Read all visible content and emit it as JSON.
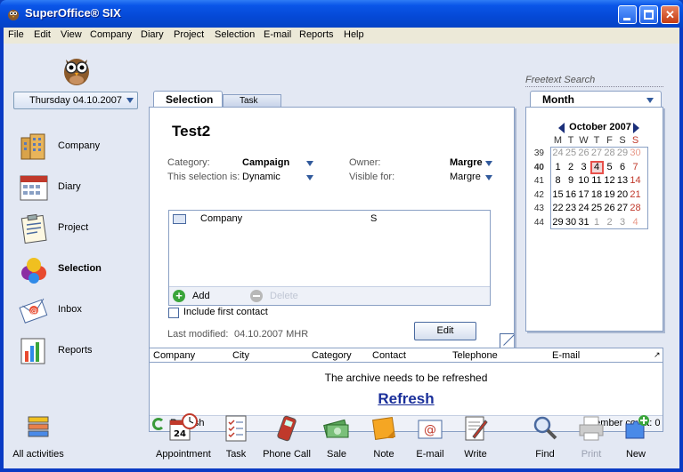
{
  "window": {
    "title": "SuperOffice® SIX"
  },
  "menu": [
    "File",
    "Edit",
    "View",
    "Company",
    "Diary",
    "Project",
    "Selection",
    "E-mail",
    "Reports",
    "Help"
  ],
  "date_select": {
    "value": "Thursday 04.10.2007"
  },
  "nav": [
    {
      "label": "Company",
      "icon": "company-building-icon"
    },
    {
      "label": "Diary",
      "icon": "diary-calendar-icon"
    },
    {
      "label": "Project",
      "icon": "project-clipboard-icon"
    },
    {
      "label": "Selection",
      "icon": "selection-balls-icon",
      "active": true
    },
    {
      "label": "Inbox",
      "icon": "inbox-envelope-icon"
    },
    {
      "label": "Reports",
      "icon": "reports-chart-icon"
    }
  ],
  "tabs": {
    "selection": "Selection",
    "task": "Task"
  },
  "selection": {
    "title": "Test2",
    "category_label": "Category:",
    "category_value": "Campaign",
    "type_label": "This selection is:",
    "type_value": "Dynamic",
    "owner_label": "Owner:",
    "owner_value": "Margre",
    "visible_label": "Visible for:",
    "visible_value": "Margre",
    "criteria_entity": "Company",
    "criteria_value": "S",
    "add_label": "Add",
    "delete_label": "Delete",
    "include_first_contact": "Include first contact",
    "last_modified_label": "Last modified:",
    "last_modified_value": "04.10.2007 MHR",
    "edit_button": "Edit"
  },
  "search": {
    "placeholder": "Freetext Search"
  },
  "calendar": {
    "view": "Month",
    "header": "October 2007",
    "days": [
      "M",
      "T",
      "W",
      "T",
      "F",
      "S",
      "S"
    ],
    "weeks": [
      "39",
      "40",
      "41",
      "42",
      "43",
      "44"
    ],
    "rows": [
      [
        "24",
        "25",
        "26",
        "27",
        "28",
        "29",
        "30"
      ],
      [
        "1",
        "2",
        "3",
        "4",
        "5",
        "6",
        "7"
      ],
      [
        "8",
        "9",
        "10",
        "11",
        "12",
        "13",
        "14"
      ],
      [
        "15",
        "16",
        "17",
        "18",
        "19",
        "20",
        "21"
      ],
      [
        "22",
        "23",
        "24",
        "25",
        "26",
        "27",
        "28"
      ],
      [
        "29",
        "30",
        "31",
        "1",
        "2",
        "3",
        "4"
      ]
    ],
    "today": "4"
  },
  "members": {
    "columns": [
      "Company",
      "City",
      "Category",
      "Contact",
      "Telephone",
      "E-mail"
    ],
    "message": "The archive needs to be refreshed",
    "refresh_link": "Refresh",
    "refresh_button": "Refresh",
    "member_count": "Member count: 0"
  },
  "bottom": [
    {
      "label": "All activities",
      "icon": "all-activities-icon"
    },
    {
      "label": "Appointment",
      "icon": "appointment-clock-icon"
    },
    {
      "label": "Task",
      "icon": "task-checklist-icon"
    },
    {
      "label": "Phone Call",
      "icon": "phone-call-icon"
    },
    {
      "label": "Sale",
      "icon": "sale-money-icon"
    },
    {
      "label": "Note",
      "icon": "note-icon"
    },
    {
      "label": "E-mail",
      "icon": "email-icon"
    },
    {
      "label": "Write",
      "icon": "write-document-icon"
    },
    {
      "label": "Find",
      "icon": "find-magnifier-icon"
    },
    {
      "label": "Print",
      "icon": "print-printer-icon",
      "disabled": true
    },
    {
      "label": "New",
      "icon": "new-puzzle-icon"
    }
  ]
}
